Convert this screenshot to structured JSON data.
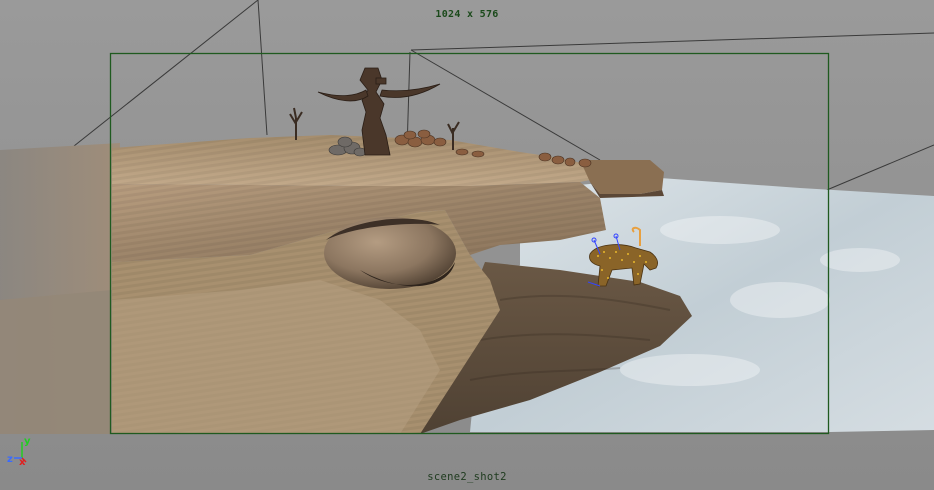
{
  "viewport": {
    "resolution_label": "1024 x 576",
    "camera_name": "scene2_shot2",
    "gate_color": "#1f5a1f",
    "background_color": "#939393",
    "sea_color": "#c4d0d6"
  },
  "axis_gizmo": {
    "y_label": "y",
    "z_label": "z",
    "x_label": "x",
    "y_color": "#22cc22",
    "z_color": "#3a6bff",
    "x_color": "#e02020"
  }
}
